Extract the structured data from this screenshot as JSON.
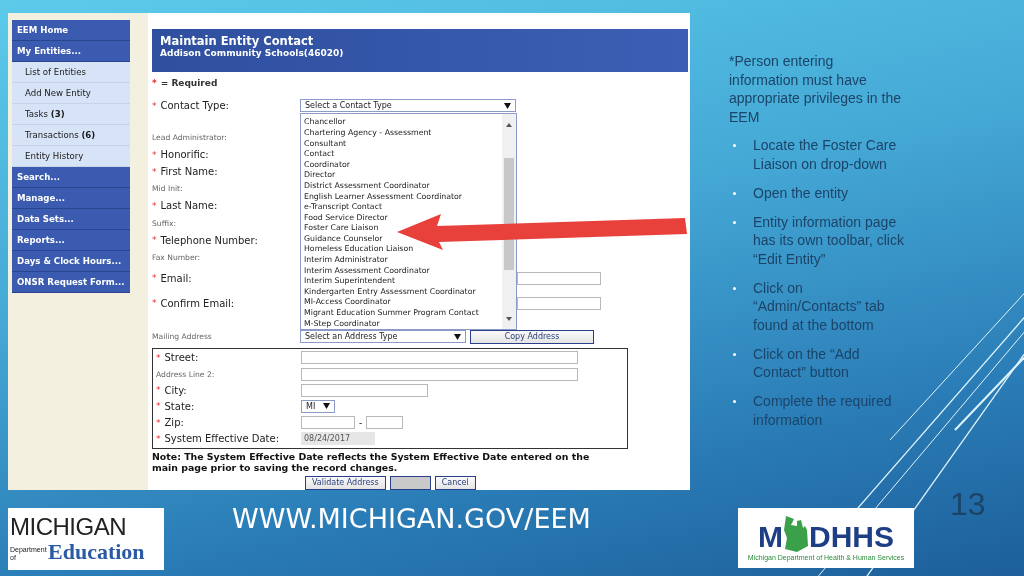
{
  "nav": [
    {
      "label": "EEM Home",
      "kind": "section"
    },
    {
      "label": "My Entities...",
      "kind": "section"
    },
    {
      "label": "List of Entities",
      "kind": "sub"
    },
    {
      "label": "Add New Entity",
      "kind": "sub"
    },
    {
      "label": "Tasks **(3)**",
      "kind": "sub"
    },
    {
      "label": "Transactions **(6)**",
      "kind": "sub"
    },
    {
      "label": "Entity History",
      "kind": "sub"
    },
    {
      "label": "Search...",
      "kind": "section"
    },
    {
      "label": "Manage...",
      "kind": "section"
    },
    {
      "label": "Data Sets...",
      "kind": "section"
    },
    {
      "label": "Reports...",
      "kind": "section"
    },
    {
      "label": "Days & Clock Hours...",
      "kind": "section"
    },
    {
      "label": "ONSR Request Form...",
      "kind": "section"
    }
  ],
  "form": {
    "title": "Maintain Entity Contact",
    "subtitle": "Addison Community Schools(46020)",
    "required_mark": "*",
    "required_legend": "= Required",
    "fields": [
      {
        "label": "Contact Type:",
        "required": true,
        "kind": "select",
        "value": "Select a Contact Type"
      },
      {
        "label": "Lead Administrator:",
        "required": false,
        "kind": "label"
      },
      {
        "label": "Honorific:",
        "required": true,
        "kind": "label"
      },
      {
        "label": "First Name:",
        "required": true,
        "kind": "label"
      },
      {
        "label": "Mid Init:",
        "required": false,
        "kind": "label"
      },
      {
        "label": "Last Name:",
        "required": true,
        "kind": "label"
      },
      {
        "label": "Suffix:",
        "required": false,
        "kind": "label"
      },
      {
        "label": "Telephone Number:",
        "required": true,
        "kind": "label"
      },
      {
        "label": "Fax Number:",
        "required": false,
        "kind": "label"
      },
      {
        "label": "Email:",
        "required": true,
        "kind": "email"
      },
      {
        "label": "Confirm Email:",
        "required": true,
        "kind": "email"
      }
    ],
    "contact_type_options": [
      "Chancellor",
      "Chartering Agency - Assessment",
      "Consultant",
      "Contact",
      "Coordinator",
      "Director",
      "District Assessment Coordinator",
      "English Learner Assessment Coordinator",
      "e-Transcript Contact",
      "Food Service Director",
      "Foster Care Liaison",
      "Guidance Counselor",
      "Homeless Education Liaison",
      "Interim Administrator",
      "Interim Assessment Coordinator",
      "Interim Superintendent",
      "Kindergarten Entry Assessment Coordinator",
      "MI-Access Coordinator",
      "Migrant Education Summer Program Contact",
      "M-Step Coordinator"
    ],
    "mailing": {
      "label": "Mailing Address",
      "value": "Select an Address Type",
      "button": "Copy Address"
    },
    "address_fields": [
      {
        "label": "Street:",
        "required": true,
        "kind": "wide"
      },
      {
        "label": "Address Line 2:",
        "required": false,
        "kind": "wide"
      },
      {
        "label": "City:",
        "required": true,
        "kind": "medium"
      },
      {
        "label": "State:",
        "required": true,
        "kind": "select",
        "value": "MI"
      },
      {
        "label": "Zip:",
        "required": true,
        "kind": "zip",
        "separator": "-"
      },
      {
        "label": "System Effective Date:",
        "required": true,
        "kind": "readonly",
        "value": "08/24/2017"
      }
    ],
    "note": "Note: The System Effective Date reflects the System Effective Date entered on the main page prior to saving the record changes.",
    "buttons": [
      {
        "label": "Validate Address",
        "kind": "text"
      },
      {
        "kind": "blank"
      },
      {
        "label": "Cancel",
        "kind": "text"
      }
    ]
  },
  "notes": {
    "intro": "*Person entering information must have appropriate privileges in the EEM",
    "steps": [
      "Locate the Foster Care Liaison on drop-down",
      "Open the entity",
      "Entity information page has its own toolbar, click “Edit Entity”",
      "Click on “Admin/Contacts” tab found at the bottom",
      "Click on the “Add Contact” button",
      "Complete the required information"
    ]
  },
  "footer": {
    "url": "WWW.MICHIGAN.GOV/EEM",
    "page_number": "13",
    "logo_left": {
      "name": "MICHIGAN",
      "dept": "Department of",
      "unit": "Education"
    },
    "logo_right": {
      "prefix": "M",
      "suffix": "DHHS",
      "caption": "Michigan Department of Health & Human Services"
    }
  }
}
